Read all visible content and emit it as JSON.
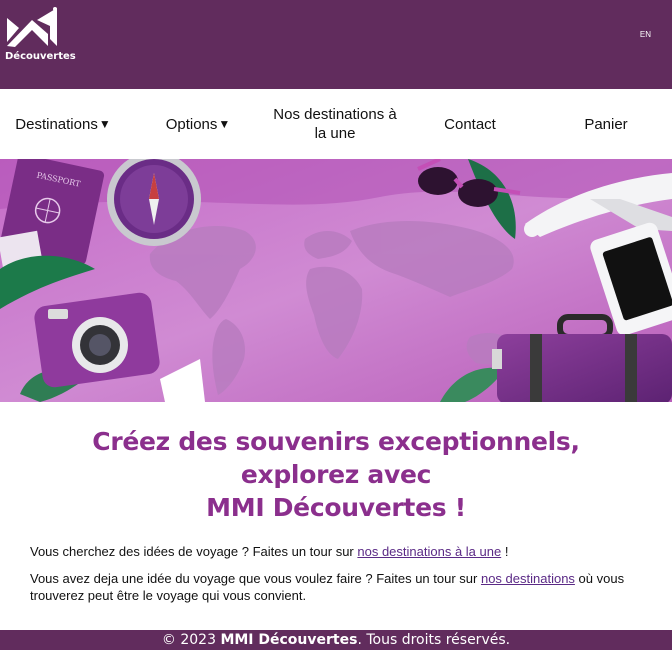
{
  "colors": {
    "brand": "#612c5d",
    "accent": "#8b2f8d",
    "link": "#5b2a86"
  },
  "header": {
    "logo_text": "Découvertes",
    "logo_icon": "mmi-logo-icon",
    "lang_link": "EN"
  },
  "nav": {
    "items": [
      {
        "label": "Destinations",
        "has_dropdown": true
      },
      {
        "label": "Options",
        "has_dropdown": true
      },
      {
        "label": "Nos destinations à la une",
        "has_dropdown": false
      },
      {
        "label": "Contact",
        "has_dropdown": false
      },
      {
        "label": "Panier",
        "has_dropdown": false
      }
    ],
    "caret": "▼"
  },
  "hero": {
    "image": "travel-banner-image"
  },
  "main": {
    "headline_line1": "Créez des souvenirs exceptionnels,",
    "headline_line2": "explorez avec",
    "headline_line3": "MMI Découvertes !",
    "p1_before": "Vous cherchez des idées de voyage ? Faites un tour sur ",
    "p1_link": "nos destinations à la une",
    "p1_after": " !",
    "p2_before": "Vous avez deja une idée du voyage que vous voulez faire ? Faites un tour sur ",
    "p2_link": "nos destinations",
    "p2_after": " où vous trouverez peut être le voyage qui vous convient."
  },
  "footer": {
    "prefix": "© 2023 ",
    "brand": "MMI Découvertes",
    "suffix": ". Tous droits réservés."
  }
}
